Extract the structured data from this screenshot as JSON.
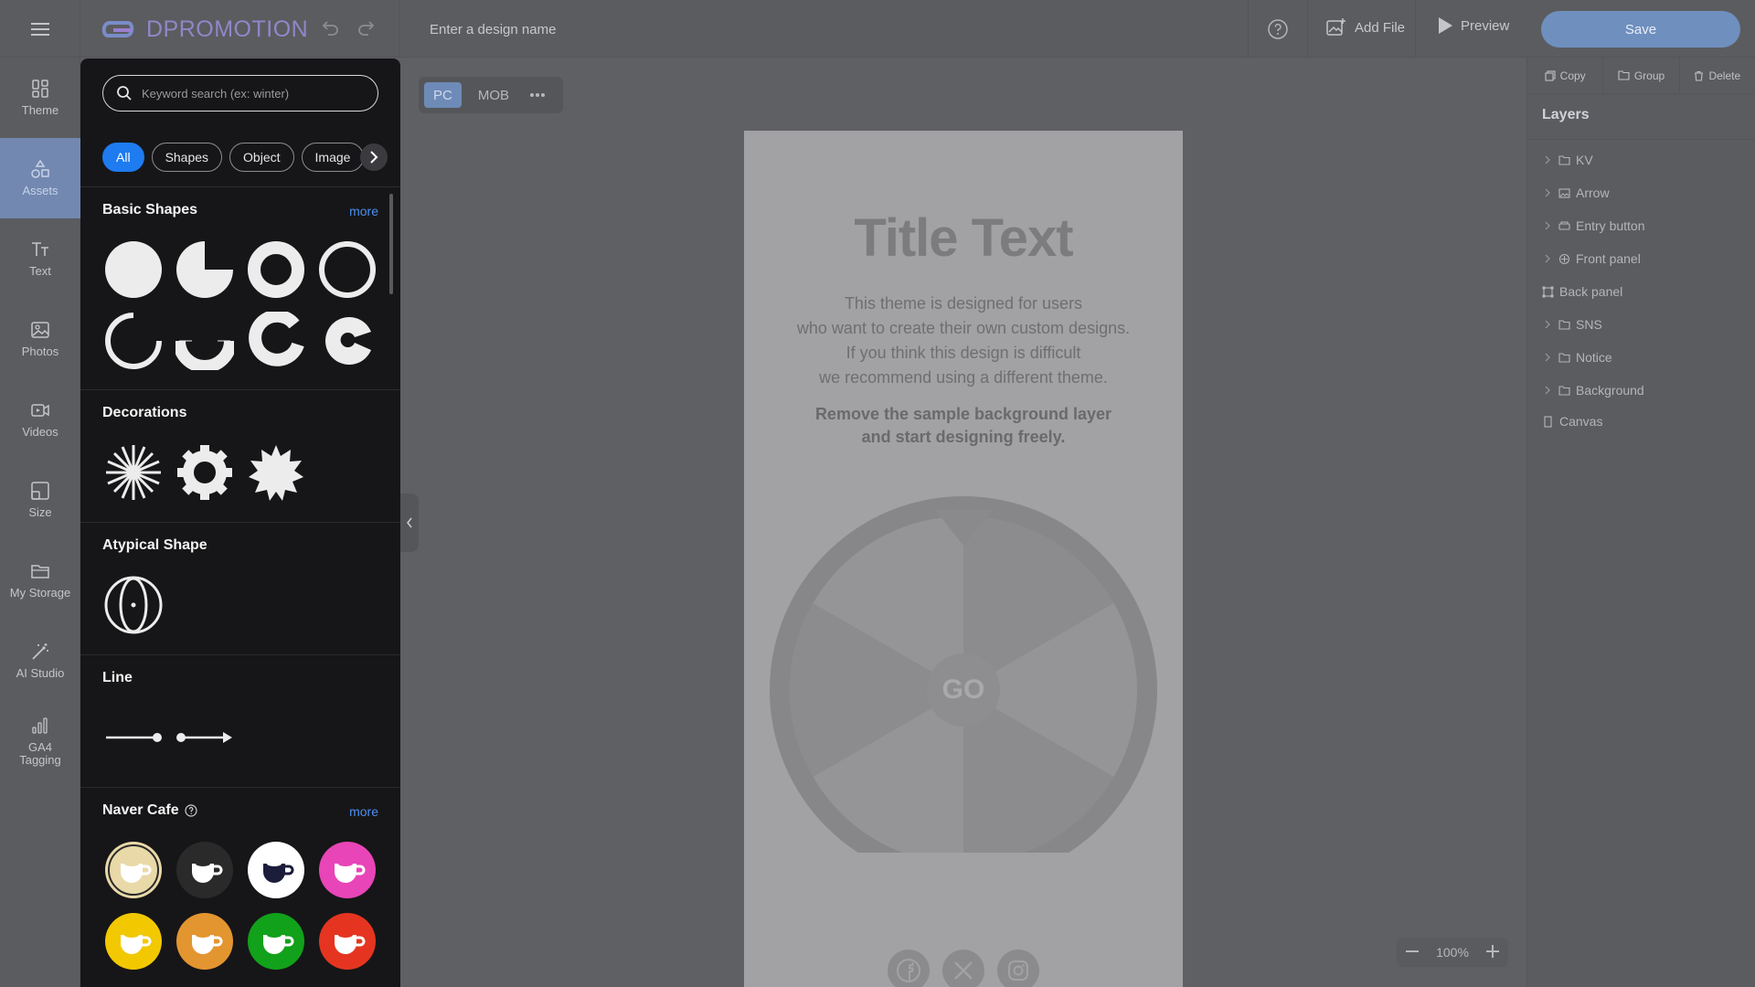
{
  "app": {
    "logo_text": "DPROMOTION",
    "design_name_placeholder": "Enter a design name",
    "add_file_label": "Add File",
    "preview_label": "Preview",
    "save_label": "Save"
  },
  "left_nav": [
    {
      "label": "Theme",
      "icon": "theme-icon"
    },
    {
      "label": "Assets",
      "icon": "assets-icon",
      "active": true
    },
    {
      "label": "Text",
      "icon": "text-icon"
    },
    {
      "label": "Photos",
      "icon": "photos-icon"
    },
    {
      "label": "Videos",
      "icon": "videos-icon"
    },
    {
      "label": "Size",
      "icon": "size-icon"
    },
    {
      "label": "My Storage",
      "icon": "folder-icon"
    },
    {
      "label": "AI Studio",
      "icon": "magic-wand-icon"
    },
    {
      "label": "GA4 Tagging",
      "icon": "bar-chart-icon"
    }
  ],
  "assets": {
    "search_placeholder": "Keyword search (ex: winter)",
    "chips": [
      "All",
      "Shapes",
      "Object",
      "Image"
    ],
    "sections": {
      "basic_shapes": {
        "title": "Basic Shapes",
        "more": "more"
      },
      "decorations": {
        "title": "Decorations"
      },
      "atypical": {
        "title": "Atypical Shape"
      },
      "line": {
        "title": "Line"
      },
      "naver_cafe": {
        "title": "Naver Cafe",
        "more": "more"
      }
    },
    "naver_cafe_colors": [
      "#e9d9a8",
      "#2a2a2a",
      "#ffffff",
      "#e845b8",
      "#f2c800",
      "#e39530",
      "#12a11a",
      "#e53520"
    ]
  },
  "device": {
    "pc": "PC",
    "mob": "MOB"
  },
  "canvas": {
    "title": "Title Text",
    "desc_lines": [
      "This theme is designed for users",
      "who want to create their own custom designs.",
      "If you think this design is difficult",
      "we recommend using a different theme."
    ],
    "desc_bold_lines": [
      "Remove the sample background layer",
      "and start designing freely."
    ],
    "go_label": "GO"
  },
  "zoom": {
    "value": "100%"
  },
  "right_panel": {
    "actions": [
      "Copy",
      "Group",
      "Delete"
    ],
    "layers_title": "Layers",
    "layers": [
      {
        "name": "KV",
        "type": "folder",
        "expandable": true
      },
      {
        "name": "Arrow",
        "type": "image",
        "expandable": true
      },
      {
        "name": "Entry button",
        "type": "button",
        "expandable": true
      },
      {
        "name": "Front panel",
        "type": "component",
        "expandable": true
      },
      {
        "name": "Back panel",
        "type": "frame",
        "expandable": false
      },
      {
        "name": "SNS",
        "type": "folder",
        "expandable": true
      },
      {
        "name": "Notice",
        "type": "folder",
        "expandable": true
      },
      {
        "name": "Background",
        "type": "folder",
        "expandable": true
      },
      {
        "name": "Canvas",
        "type": "page",
        "expandable": false
      }
    ]
  }
}
